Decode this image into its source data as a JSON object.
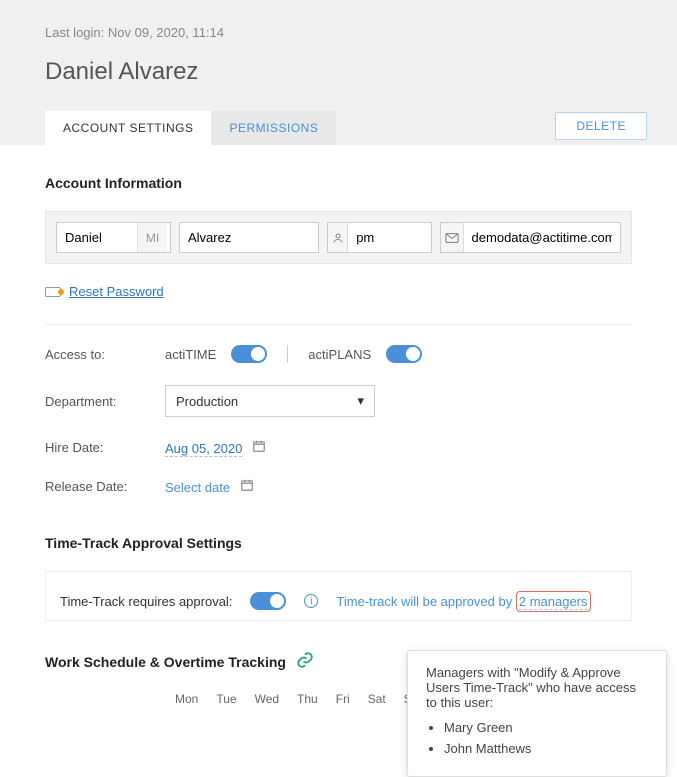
{
  "header": {
    "last_login": "Last login: Nov 09, 2020, 11:14",
    "user_name": "Daniel Alvarez"
  },
  "tabs": {
    "account_settings": "ACCOUNT SETTINGS",
    "permissions": "PERMISSIONS",
    "delete": "DELETE"
  },
  "account_info": {
    "title": "Account Information",
    "first_name": "Daniel",
    "mi_label": "MI",
    "last_name": "Alvarez",
    "username": "pm",
    "email": "demodata@actitime.com",
    "reset_password": "Reset Password"
  },
  "access": {
    "label": "Access to:",
    "p1": "actiTIME",
    "p2": "actiPLANS"
  },
  "department": {
    "label": "Department:",
    "value": "Production"
  },
  "hire": {
    "label": "Hire Date:",
    "value": "Aug 05, 2020"
  },
  "release": {
    "label": "Release Date:",
    "value": "Select date"
  },
  "tt": {
    "title": "Time-Track Approval Settings",
    "label": "Time-Track requires approval:",
    "info_text": "Time-track will be approved by",
    "mgr_link": "2 managers"
  },
  "popover": {
    "desc": "Managers with \"Modify & Approve Users Time-Track\" who have access to this user:",
    "m1": "Mary Green",
    "m2": "John Matthews"
  },
  "schedule": {
    "title": "Work Schedule & Overtime Tracking",
    "days": [
      "Mon",
      "Tue",
      "Wed",
      "Thu",
      "Fri",
      "Sat",
      "Sun"
    ]
  }
}
